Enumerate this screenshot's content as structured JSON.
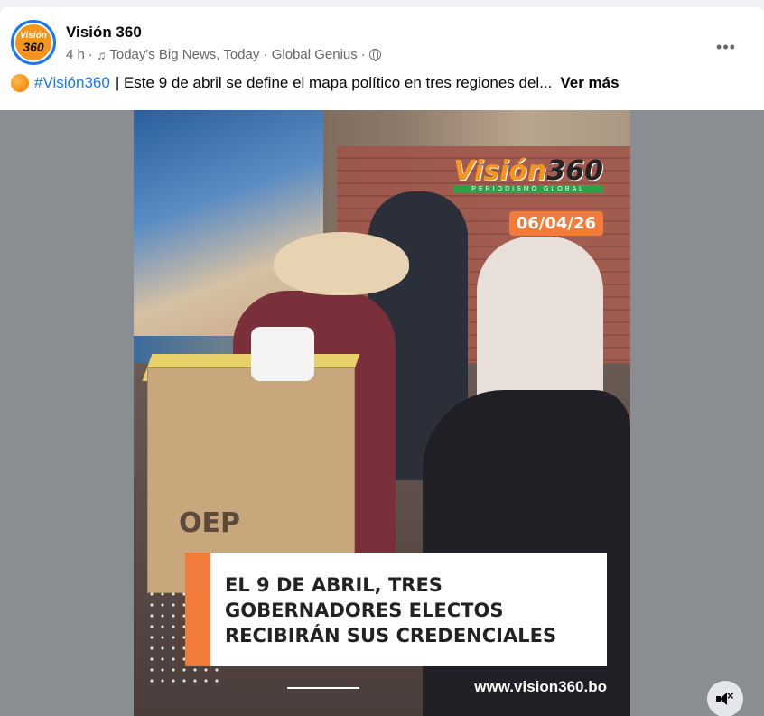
{
  "post": {
    "avatar_line1": "Visión",
    "avatar_line2": "360",
    "page_name": "Visión 360",
    "time": "4 h",
    "separator": "·",
    "audio_track": "Today's Big News, Today · Global Genius",
    "audience_icon": "globe-icon",
    "more_icon": "more-options-icon",
    "more_label": "•••"
  },
  "caption": {
    "emoji_icon": "orange-circle-icon",
    "hashtag": "#Visión360",
    "text": "| Este 9 de abril se define el mapa político en tres regiones del...",
    "see_more": "Ver más"
  },
  "video": {
    "logo_text_word": "Visión",
    "logo_text_num": "360",
    "logo_tagline": "PERIODISMO GLOBAL",
    "date": "06/04/26",
    "box_label": "OEP",
    "headline_line1": "EL 9 DE ABRIL, TRES",
    "headline_line2": "GOBERNADORES ELECTOS",
    "headline_line3": "RECIBIRÁN SUS CREDENCIALES",
    "website": "www.vision360.bo",
    "mute_icon": "speaker-muted-icon",
    "mute_x": "×"
  },
  "colors": {
    "accent_orange": "#f37b3a",
    "brand_green": "#2aa24a",
    "link_blue": "#1877f2"
  }
}
